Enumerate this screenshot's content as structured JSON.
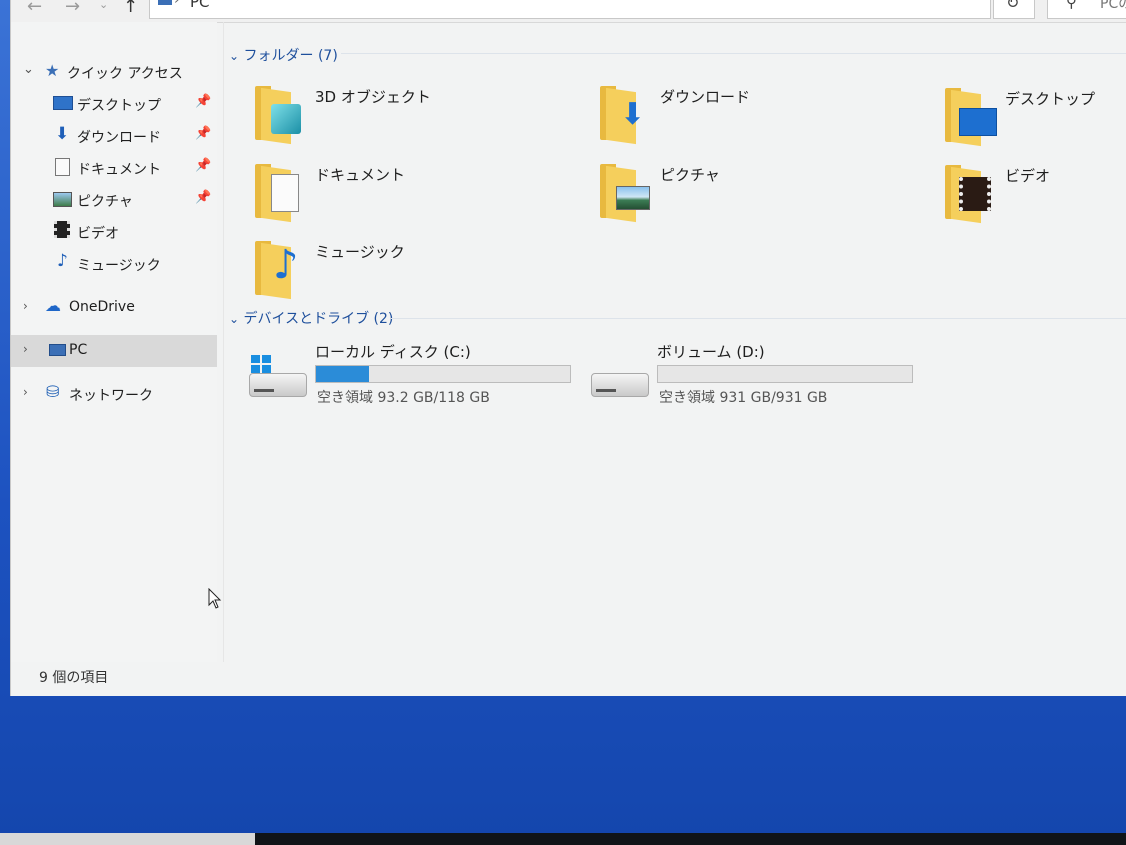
{
  "address_bar": {
    "path": "PC",
    "search_placeholder": "PCの"
  },
  "sidebar": {
    "quick_access": {
      "label": "クイック アクセス",
      "items": [
        {
          "label": "デスクトップ",
          "pinned": true,
          "icon": "desktop-icon"
        },
        {
          "label": "ダウンロード",
          "pinned": true,
          "icon": "download-icon"
        },
        {
          "label": "ドキュメント",
          "pinned": true,
          "icon": "document-icon"
        },
        {
          "label": "ピクチャ",
          "pinned": true,
          "icon": "picture-icon"
        },
        {
          "label": "ビデオ",
          "pinned": false,
          "icon": "video-icon"
        },
        {
          "label": "ミュージック",
          "pinned": false,
          "icon": "music-icon"
        }
      ]
    },
    "onedrive": "OneDrive",
    "pc": "PC",
    "network": "ネットワーク"
  },
  "content": {
    "folders_header": "フォルダー (7)",
    "folders": [
      {
        "label": "3D オブジェクト",
        "icon": "3d-objects-folder-icon"
      },
      {
        "label": "ダウンロード",
        "icon": "downloads-folder-icon"
      },
      {
        "label": "デスクトップ",
        "icon": "desktop-folder-icon"
      },
      {
        "label": "ドキュメント",
        "icon": "documents-folder-icon"
      },
      {
        "label": "ピクチャ",
        "icon": "pictures-folder-icon"
      },
      {
        "label": "ビデオ",
        "icon": "videos-folder-icon"
      },
      {
        "label": "ミュージック",
        "icon": "music-folder-icon"
      }
    ],
    "devices_header": "デバイスとドライブ (2)",
    "drives": [
      {
        "name": "ローカル ディスク (C:)",
        "free_text": "空き領域 93.2 GB/118 GB",
        "used_fraction": 0.21,
        "icon": "windows-drive-icon"
      },
      {
        "name": "ボリューム (D:)",
        "free_text": "空き領域 931 GB/931 GB",
        "used_fraction": 0.0,
        "icon": "drive-icon"
      }
    ]
  },
  "status_bar": {
    "item_count": "9 個の項目"
  },
  "colors": {
    "accent": "#2b8cd8",
    "folder": "#f5cf5c",
    "desktop": "#1d52c0"
  }
}
